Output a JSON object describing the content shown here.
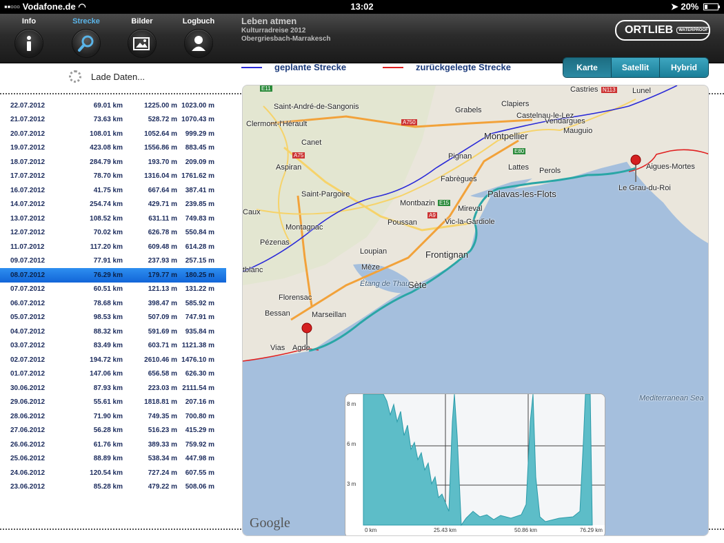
{
  "statusbar": {
    "carrier": "Vodafone.de",
    "time": "13:02",
    "battery": "20%"
  },
  "tabs": [
    {
      "label": "Info",
      "icon": "info-icon",
      "active": false
    },
    {
      "label": "Strecke",
      "icon": "search-icon",
      "active": true
    },
    {
      "label": "Bilder",
      "icon": "picture-icon",
      "active": false
    },
    {
      "label": "Logbuch",
      "icon": "person-icon",
      "active": false
    }
  ],
  "trip": {
    "title": "Leben atmen",
    "subtitle": "Kulturradreise 2012",
    "route": "Obergriesbach-Marrakesch"
  },
  "logo": {
    "text": "ORTLIEB",
    "badge": "WATERPROOF"
  },
  "loading_text": "Lade Daten...",
  "legend": {
    "planned": "geplante Strecke",
    "traveled": "zurückgelegte Strecke",
    "planned_color": "#2a2ad8",
    "traveled_color": "#e02020"
  },
  "map_types": [
    "Karte",
    "Satellit",
    "Hybrid"
  ],
  "map_type_selected": "Karte",
  "days": [
    [
      "22.07.2012",
      "69.01 km",
      "1225.00 m",
      "1023.00 m"
    ],
    [
      "21.07.2012",
      "73.63 km",
      "528.72 m",
      "1070.43 m"
    ],
    [
      "20.07.2012",
      "108.01 km",
      "1052.64 m",
      "999.29 m"
    ],
    [
      "19.07.2012",
      "423.08 km",
      "1556.86 m",
      "883.45 m"
    ],
    [
      "18.07.2012",
      "284.79 km",
      "193.70 m",
      "209.09 m"
    ],
    [
      "17.07.2012",
      "78.70 km",
      "1316.04 m",
      "1761.62 m"
    ],
    [
      "16.07.2012",
      "41.75 km",
      "667.64 m",
      "387.41 m"
    ],
    [
      "14.07.2012",
      "254.74 km",
      "429.71 m",
      "239.85 m"
    ],
    [
      "13.07.2012",
      "108.52 km",
      "631.11 m",
      "749.83 m"
    ],
    [
      "12.07.2012",
      "70.02 km",
      "626.78 m",
      "550.84 m"
    ],
    [
      "11.07.2012",
      "117.20 km",
      "609.48 m",
      "614.28 m"
    ],
    [
      "09.07.2012",
      "77.91 km",
      "237.93 m",
      "257.15 m"
    ],
    [
      "08.07.2012",
      "76.29 km",
      "179.77 m",
      "180.25 m"
    ],
    [
      "07.07.2012",
      "60.51 km",
      "121.13 m",
      "131.22 m"
    ],
    [
      "06.07.2012",
      "78.68 km",
      "398.47 m",
      "585.92 m"
    ],
    [
      "05.07.2012",
      "98.53 km",
      "507.09 m",
      "747.91 m"
    ],
    [
      "04.07.2012",
      "88.32 km",
      "591.69 m",
      "935.84 m"
    ],
    [
      "03.07.2012",
      "83.49 km",
      "603.71 m",
      "1121.38 m"
    ],
    [
      "02.07.2012",
      "194.72 km",
      "2610.46 m",
      "1476.10 m"
    ],
    [
      "01.07.2012",
      "147.06 km",
      "656.58 m",
      "626.30 m"
    ],
    [
      "30.06.2012",
      "87.93 km",
      "223.03 m",
      "2111.54 m"
    ],
    [
      "29.06.2012",
      "55.61 km",
      "1818.81 m",
      "207.16 m"
    ],
    [
      "28.06.2012",
      "71.90 km",
      "749.35 m",
      "700.80 m"
    ],
    [
      "27.06.2012",
      "56.28 km",
      "516.23 m",
      "415.29 m"
    ],
    [
      "26.06.2012",
      "61.76 km",
      "389.33 m",
      "759.92 m"
    ],
    [
      "25.06.2012",
      "88.89 km",
      "538.34 m",
      "447.98 m"
    ],
    [
      "24.06.2012",
      "120.54 km",
      "727.24 m",
      "607.55 m"
    ],
    [
      "23.06.2012",
      "85.28 km",
      "479.22 m",
      "508.06 m"
    ]
  ],
  "selected_day": "08.07.2012",
  "map_labels": [
    "Saint-André-de-Sangonis",
    "Clermont-l'Hérault",
    "Canet",
    "Aspiran",
    "Saint-Pargoire",
    "Caux",
    "Montagnac",
    "Pézenas",
    "Florensac",
    "Bessan",
    "Marseillan",
    "Vias",
    "Agde",
    "Montpellier",
    "Grabels",
    "Clapiers",
    "Castelnau-le-Lez",
    "Vendargues",
    "Mauguio",
    "Castries",
    "Lunel",
    "Pignan",
    "Lattes",
    "Perols",
    "Fabrègues",
    "Montbazin",
    "Poussan",
    "Mireval",
    "Vic-la-Gardiole",
    "Palavas-les-Flots",
    "Loupian",
    "Frontignan",
    "Mèze",
    "Sète",
    "Étang de Thau",
    "Aigues-Mortes",
    "Le Grau-du-Roi",
    "Mediterranean Sea",
    "tblanc"
  ],
  "road_labels": [
    "E11",
    "A750",
    "A75",
    "E80",
    "E15",
    "A9",
    "N113"
  ],
  "map_attribution": "Google",
  "elevation_profile": {
    "y_ticks": [
      "8 m",
      "6 m",
      "3 m"
    ],
    "x_ticks": [
      "0 km",
      "25.43 km",
      "50.86 km",
      "76.29 km"
    ]
  }
}
